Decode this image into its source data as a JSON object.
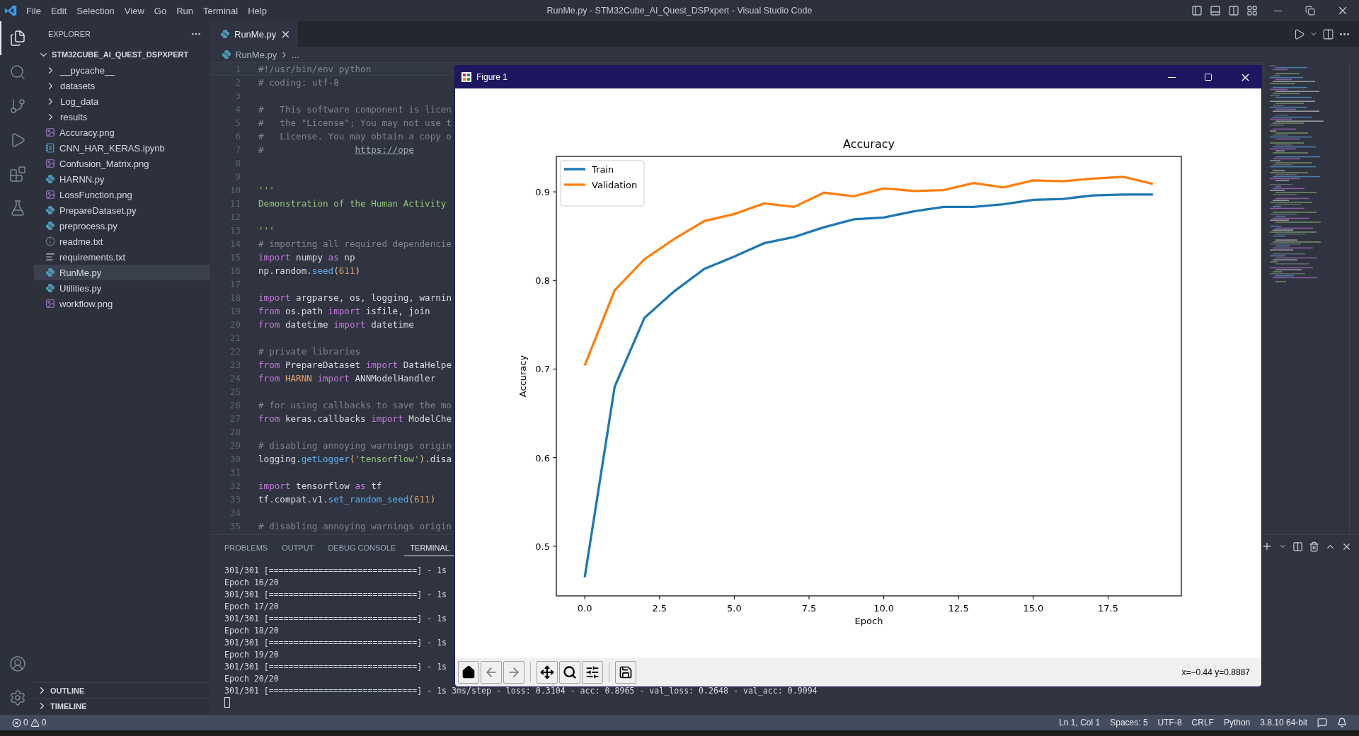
{
  "title_bar": {
    "menu": [
      "File",
      "Edit",
      "Selection",
      "View",
      "Go",
      "Run",
      "Terminal",
      "Help"
    ],
    "title": "RunMe.py - STM32Cube_AI_Quest_DSPxpert - Visual Studio Code"
  },
  "activity_bar": {
    "items": [
      {
        "kind": "explorer",
        "selected": true
      },
      {
        "kind": "search",
        "selected": false
      },
      {
        "kind": "source-control",
        "selected": false
      },
      {
        "kind": "run",
        "selected": false
      },
      {
        "kind": "extensions",
        "selected": false
      },
      {
        "kind": "testing",
        "selected": false
      }
    ],
    "bottom_items": [
      {
        "kind": "account",
        "selected": false
      },
      {
        "kind": "settings",
        "selected": false
      }
    ]
  },
  "sidebar": {
    "title": "EXPLORER",
    "folder": {
      "name": "STM32CUBE_AI_QUEST_DSPXPERT",
      "expanded": true,
      "children": [
        {
          "kind": "folder",
          "name": "__pycache__",
          "expanded": false,
          "selected": false
        },
        {
          "kind": "folder",
          "name": "datasets",
          "expanded": false,
          "selected": false
        },
        {
          "kind": "folder",
          "name": "Log_data",
          "expanded": false,
          "selected": false
        },
        {
          "kind": "folder",
          "name": "results",
          "expanded": false,
          "selected": false
        },
        {
          "kind": "image",
          "name": "Accuracy.png",
          "selected": false
        },
        {
          "kind": "notebook",
          "name": "CNN_HAR_KERAS.ipynb",
          "selected": false
        },
        {
          "kind": "image",
          "name": "Confusion_Matrix.png",
          "selected": false
        },
        {
          "kind": "python",
          "name": "HARNN.py",
          "selected": false
        },
        {
          "kind": "image",
          "name": "LossFunction.png",
          "selected": false
        },
        {
          "kind": "python",
          "name": "PrepareDataset.py",
          "selected": false
        },
        {
          "kind": "python",
          "name": "preprocess.py",
          "selected": false
        },
        {
          "kind": "info",
          "name": "readme.txt",
          "selected": false
        },
        {
          "kind": "text",
          "name": "requirements.txt",
          "selected": false
        },
        {
          "kind": "python",
          "name": "RunMe.py",
          "selected": true
        },
        {
          "kind": "python",
          "name": "Utilities.py",
          "selected": false
        },
        {
          "kind": "image",
          "name": "workflow.png",
          "selected": false
        }
      ]
    },
    "sections": [
      {
        "name": "OUTLINE",
        "expanded": false
      },
      {
        "name": "TIMELINE",
        "expanded": false
      }
    ]
  },
  "editor": {
    "tabs": [
      {
        "label": "RunMe.py",
        "selected": true
      }
    ],
    "breadcrumb": [
      "RunMe.py",
      "..."
    ],
    "lines": [
      {
        "number": "1",
        "current": true,
        "tokens": [
          {
            "kind": "comment",
            "text": "#!/usr/bin/env python"
          }
        ]
      },
      {
        "number": "2",
        "current": false,
        "tokens": [
          {
            "kind": "comment",
            "text": "# coding: utf-8"
          }
        ]
      },
      {
        "number": "3",
        "current": false
      },
      {
        "number": "4",
        "current": false,
        "tokens": [
          {
            "kind": "comment",
            "text": "#   This software component is licen"
          }
        ]
      },
      {
        "number": "5",
        "current": false,
        "tokens": [
          {
            "kind": "comment",
            "text": "#   the \"License\"; You may not use t"
          }
        ]
      },
      {
        "number": "6",
        "current": false,
        "tokens": [
          {
            "kind": "comment",
            "text": "#   License. You may obtain a copy o"
          }
        ]
      },
      {
        "number": "7",
        "current": false,
        "tokens": [
          {
            "kind": "comment",
            "text": "#                 "
          },
          {
            "kind": "link",
            "text": "https://ope"
          }
        ]
      },
      {
        "number": "8",
        "current": false
      },
      {
        "number": "9",
        "current": false
      },
      {
        "number": "10",
        "current": false,
        "tokens": [
          {
            "kind": "doc",
            "text": "'''"
          }
        ]
      },
      {
        "number": "11",
        "current": false,
        "tokens": [
          {
            "kind": "doc",
            "text": "Demonstration of the Human Activity"
          }
        ]
      },
      {
        "number": "12",
        "current": false
      },
      {
        "number": "13",
        "current": false,
        "tokens": [
          {
            "kind": "doc",
            "text": "'''"
          }
        ]
      },
      {
        "number": "14",
        "current": false,
        "tokens": [
          {
            "kind": "comment",
            "text": "# importing all required dependencie"
          }
        ]
      },
      {
        "number": "15",
        "current": false,
        "tokens": [
          {
            "kind": "keyword",
            "text": "import"
          },
          {
            "kind": "plain",
            "text": " numpy "
          },
          {
            "kind": "keyword",
            "text": "as"
          },
          {
            "kind": "plain",
            "text": " np"
          }
        ]
      },
      {
        "number": "16",
        "current": false,
        "tokens": [
          {
            "kind": "plain",
            "text": "np.random."
          },
          {
            "kind": "function",
            "text": "seed"
          },
          {
            "kind": "bracket",
            "text": "("
          },
          {
            "kind": "number",
            "text": "611"
          },
          {
            "kind": "bracket",
            "text": ")"
          }
        ]
      },
      {
        "number": "17",
        "current": false
      },
      {
        "number": "18",
        "current": false,
        "tokens": [
          {
            "kind": "keyword",
            "text": "import"
          },
          {
            "kind": "plain",
            "text": " argparse, os, logging, warnin"
          }
        ]
      },
      {
        "number": "19",
        "current": false,
        "tokens": [
          {
            "kind": "keyword",
            "text": "from"
          },
          {
            "kind": "plain",
            "text": " os.path "
          },
          {
            "kind": "keyword",
            "text": "import"
          },
          {
            "kind": "plain",
            "text": " isfile, join"
          }
        ]
      },
      {
        "number": "20",
        "current": false,
        "tokens": [
          {
            "kind": "keyword",
            "text": "from"
          },
          {
            "kind": "plain",
            "text": " datetime "
          },
          {
            "kind": "keyword",
            "text": "import"
          },
          {
            "kind": "plain",
            "text": " datetime"
          }
        ]
      },
      {
        "number": "21",
        "current": false
      },
      {
        "number": "22",
        "current": false,
        "tokens": [
          {
            "kind": "comment",
            "text": "# private libraries"
          }
        ]
      },
      {
        "number": "23",
        "current": false,
        "tokens": [
          {
            "kind": "keyword",
            "text": "from"
          },
          {
            "kind": "plain",
            "text": " PrepareDataset "
          },
          {
            "kind": "keyword",
            "text": "import"
          },
          {
            "kind": "plain",
            "text": " DataHelpe"
          }
        ]
      },
      {
        "number": "24",
        "current": false,
        "tokens": [
          {
            "kind": "keyword",
            "text": "from "
          },
          {
            "kind": "module",
            "text": "HARNN"
          },
          {
            "kind": "keyword",
            "text": " import"
          },
          {
            "kind": "plain",
            "text": " ANNModelHandler"
          }
        ]
      },
      {
        "number": "25",
        "current": false
      },
      {
        "number": "26",
        "current": false,
        "tokens": [
          {
            "kind": "comment",
            "text": "# for using callbacks to save the mo"
          }
        ]
      },
      {
        "number": "27",
        "current": false,
        "tokens": [
          {
            "kind": "keyword",
            "text": "from"
          },
          {
            "kind": "plain",
            "text": " keras.callbacks "
          },
          {
            "kind": "keyword",
            "text": "import"
          },
          {
            "kind": "plain",
            "text": " ModelChe"
          }
        ]
      },
      {
        "number": "28",
        "current": false
      },
      {
        "number": "29",
        "current": false,
        "tokens": [
          {
            "kind": "comment",
            "text": "# disabling annoying warnings origin"
          }
        ]
      },
      {
        "number": "30",
        "current": false,
        "tokens": [
          {
            "kind": "plain",
            "text": "logging."
          },
          {
            "kind": "function",
            "text": "getLogger"
          },
          {
            "kind": "bracket",
            "text": "("
          },
          {
            "kind": "string",
            "text": "'tensorflow'"
          },
          {
            "kind": "bracket",
            "text": ")"
          },
          {
            "kind": "plain",
            "text": ".disa"
          }
        ]
      },
      {
        "number": "31",
        "current": false
      },
      {
        "number": "32",
        "current": false,
        "tokens": [
          {
            "kind": "keyword",
            "text": "import"
          },
          {
            "kind": "plain",
            "text": " tensorflow "
          },
          {
            "kind": "keyword",
            "text": "as"
          },
          {
            "kind": "plain",
            "text": " tf"
          }
        ]
      },
      {
        "number": "33",
        "current": false,
        "tokens": [
          {
            "kind": "plain",
            "text": "tf.compat.v1."
          },
          {
            "kind": "function",
            "text": "set_random_seed"
          },
          {
            "kind": "bracket",
            "text": "("
          },
          {
            "kind": "number",
            "text": "611"
          },
          {
            "kind": "bracket",
            "text": ")"
          }
        ]
      },
      {
        "number": "34",
        "current": false
      },
      {
        "number": "35",
        "current": false,
        "tokens": [
          {
            "kind": "comment",
            "text": "# disabling annoying warnings origin"
          }
        ]
      }
    ]
  },
  "panel": {
    "tabs": [
      {
        "label": "PROBLEMS",
        "selected": false
      },
      {
        "label": "OUTPUT",
        "selected": false
      },
      {
        "label": "DEBUG CONSOLE",
        "selected": false
      },
      {
        "label": "TERMINAL",
        "selected": true
      }
    ],
    "terminal": [
      "301/301 [==============================] - 1s",
      "Epoch 16/20",
      "301/301 [==============================] - 1s",
      "Epoch 17/20",
      "301/301 [==============================] - 1s",
      "Epoch 18/20",
      "301/301 [==============================] - 1s",
      "Epoch 19/20",
      "301/301 [==============================] - 1s",
      "Epoch 20/20",
      "301/301 [==============================] - 1s 3ms/step - loss: 0.3104 - acc: 0.8965 - val_loss: 0.2648 - val_acc: 0.9094"
    ]
  },
  "figure": {
    "title": "Figure 1",
    "coordinates": "x=−0.44 y=0.8887",
    "chart_data": {
      "type": "line",
      "title": "Accuracy",
      "xlabel": "Epoch",
      "ylabel": "Accuracy",
      "x": [
        0,
        1,
        2,
        3,
        4,
        5,
        6,
        7,
        8,
        9,
        10,
        11,
        12,
        13,
        14,
        15,
        16,
        17,
        18,
        19
      ],
      "series": [
        {
          "name": "Train",
          "color": "#1f77b4",
          "values": [
            0.465,
            0.68,
            0.758,
            0.788,
            0.813,
            0.827,
            0.842,
            0.849,
            0.86,
            0.869,
            0.871,
            0.878,
            0.883,
            0.883,
            0.886,
            0.891,
            0.892,
            0.896,
            0.897,
            0.897
          ]
        },
        {
          "name": "Validation",
          "color": "#ff7f0e",
          "values": [
            0.704,
            0.789,
            0.824,
            0.847,
            0.867,
            0.875,
            0.887,
            0.883,
            0.899,
            0.895,
            0.904,
            0.901,
            0.902,
            0.91,
            0.905,
            0.913,
            0.912,
            0.915,
            0.917,
            0.909
          ]
        }
      ],
      "legend": "upper left",
      "xlim": [
        -0.95,
        19.95
      ],
      "ylim": [
        0.444,
        0.94
      ],
      "xticks": [
        {
          "value": 0,
          "label": "0.0"
        },
        {
          "value": 2.5,
          "label": "2.5"
        },
        {
          "value": 5,
          "label": "5.0"
        },
        {
          "value": 7.5,
          "label": "7.5"
        },
        {
          "value": 10,
          "label": "10.0"
        },
        {
          "value": 12.5,
          "label": "12.5"
        },
        {
          "value": 15,
          "label": "15.0"
        },
        {
          "value": 17.5,
          "label": "17.5"
        }
      ],
      "yticks": [
        {
          "value": 0.5,
          "label": "0.5"
        },
        {
          "value": 0.6,
          "label": "0.6"
        },
        {
          "value": 0.7,
          "label": "0.7"
        },
        {
          "value": 0.8,
          "label": "0.8"
        },
        {
          "value": 0.9,
          "label": "0.9"
        }
      ]
    }
  },
  "status_bar": {
    "errors": "0",
    "warnings": "0",
    "items": [
      "Ln 1, Col 1",
      "Spaces: 5",
      "UTF-8",
      "CRLF",
      "Python",
      "3.8.10 64-bit"
    ]
  }
}
